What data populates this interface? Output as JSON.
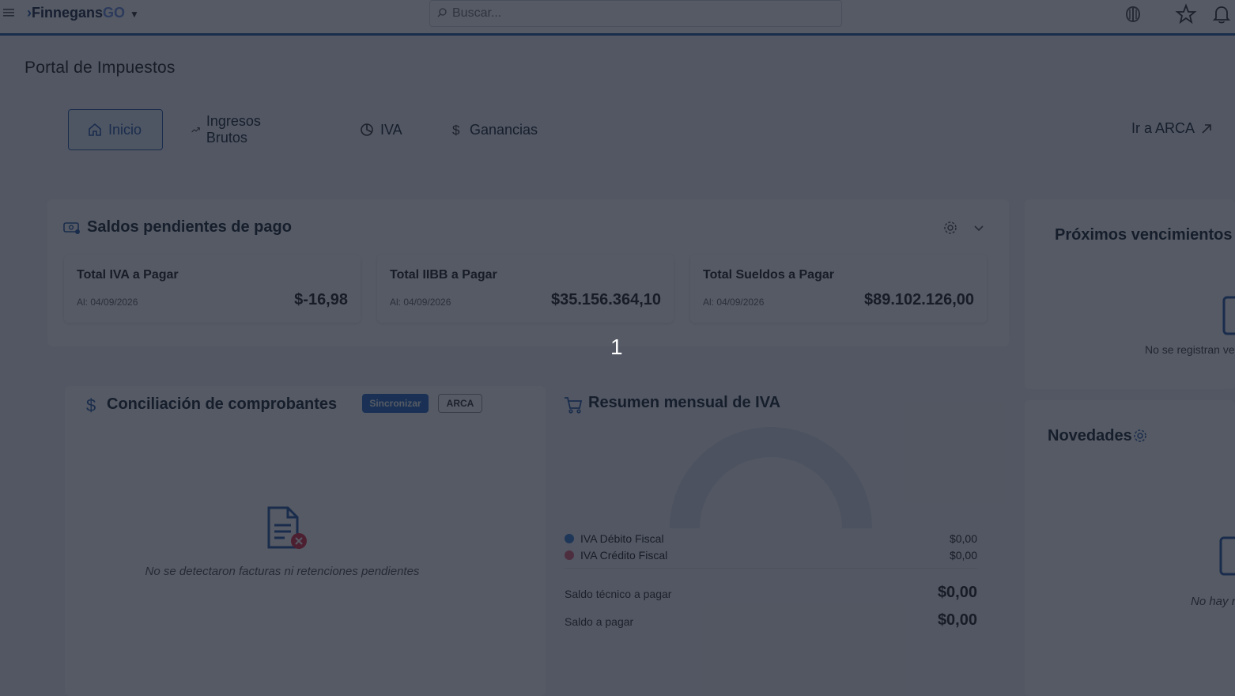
{
  "topbar": {
    "menu_icon": "hamburger-icon",
    "logo_text": "Finnegans",
    "logo_suffix": "GO",
    "search_placeholder": "Buscar...",
    "icons": [
      "brain-icon",
      "star-icon",
      "bell-icon"
    ]
  },
  "page": {
    "title": "Portal de Impuestos"
  },
  "tabs": [
    {
      "label": "Inicio",
      "icon": "home-icon",
      "active": true
    },
    {
      "label": "Ingresos Brutos",
      "icon": "trending-up-icon"
    },
    {
      "label": "IVA",
      "icon": "pie-chart-icon"
    },
    {
      "label": "Ganancias",
      "icon": "dollar-icon"
    }
  ],
  "arca_link": "Ir a ARCA",
  "saldos": {
    "title": "Saldos pendientes de pago",
    "cards": [
      {
        "label": "Total IVA a Pagar",
        "date": "Al: 04/09/2026",
        "amount": "$-16,98"
      },
      {
        "label": "Total IIBB a Pagar",
        "date": "Al: 04/09/2026",
        "amount": "$35.156.364,10"
      },
      {
        "label": "Total Sueldos a Pagar",
        "date": "Al: 04/09/2026",
        "amount": "$89.102.126,00"
      }
    ]
  },
  "conciliacion": {
    "title": "Conciliación de comprobantes",
    "sync_button": "Sincronizar",
    "arca_button": "ARCA",
    "empty_text": "No se detectaron facturas ni retenciones pendientes"
  },
  "resumen_iva": {
    "title": "Resumen mensual de IVA",
    "legend": [
      {
        "label": "IVA Débito Fiscal",
        "value": "$0,00",
        "color": "#3b7fd4"
      },
      {
        "label": "IVA Crédito Fiscal",
        "value": "$0,00",
        "color": "#e0607a"
      }
    ],
    "saldo_tecnico_label": "Saldo técnico a pagar",
    "saldo_tecnico_value": "$0,00",
    "saldo_label": "Saldo a pagar",
    "saldo_value": "$0,00"
  },
  "proximos": {
    "title": "Próximos vencimientos",
    "empty_text": "No se registran ve"
  },
  "novedades": {
    "title": "Novedades",
    "empty_text": "No hay n"
  },
  "overlay": {
    "step_number": "1"
  }
}
